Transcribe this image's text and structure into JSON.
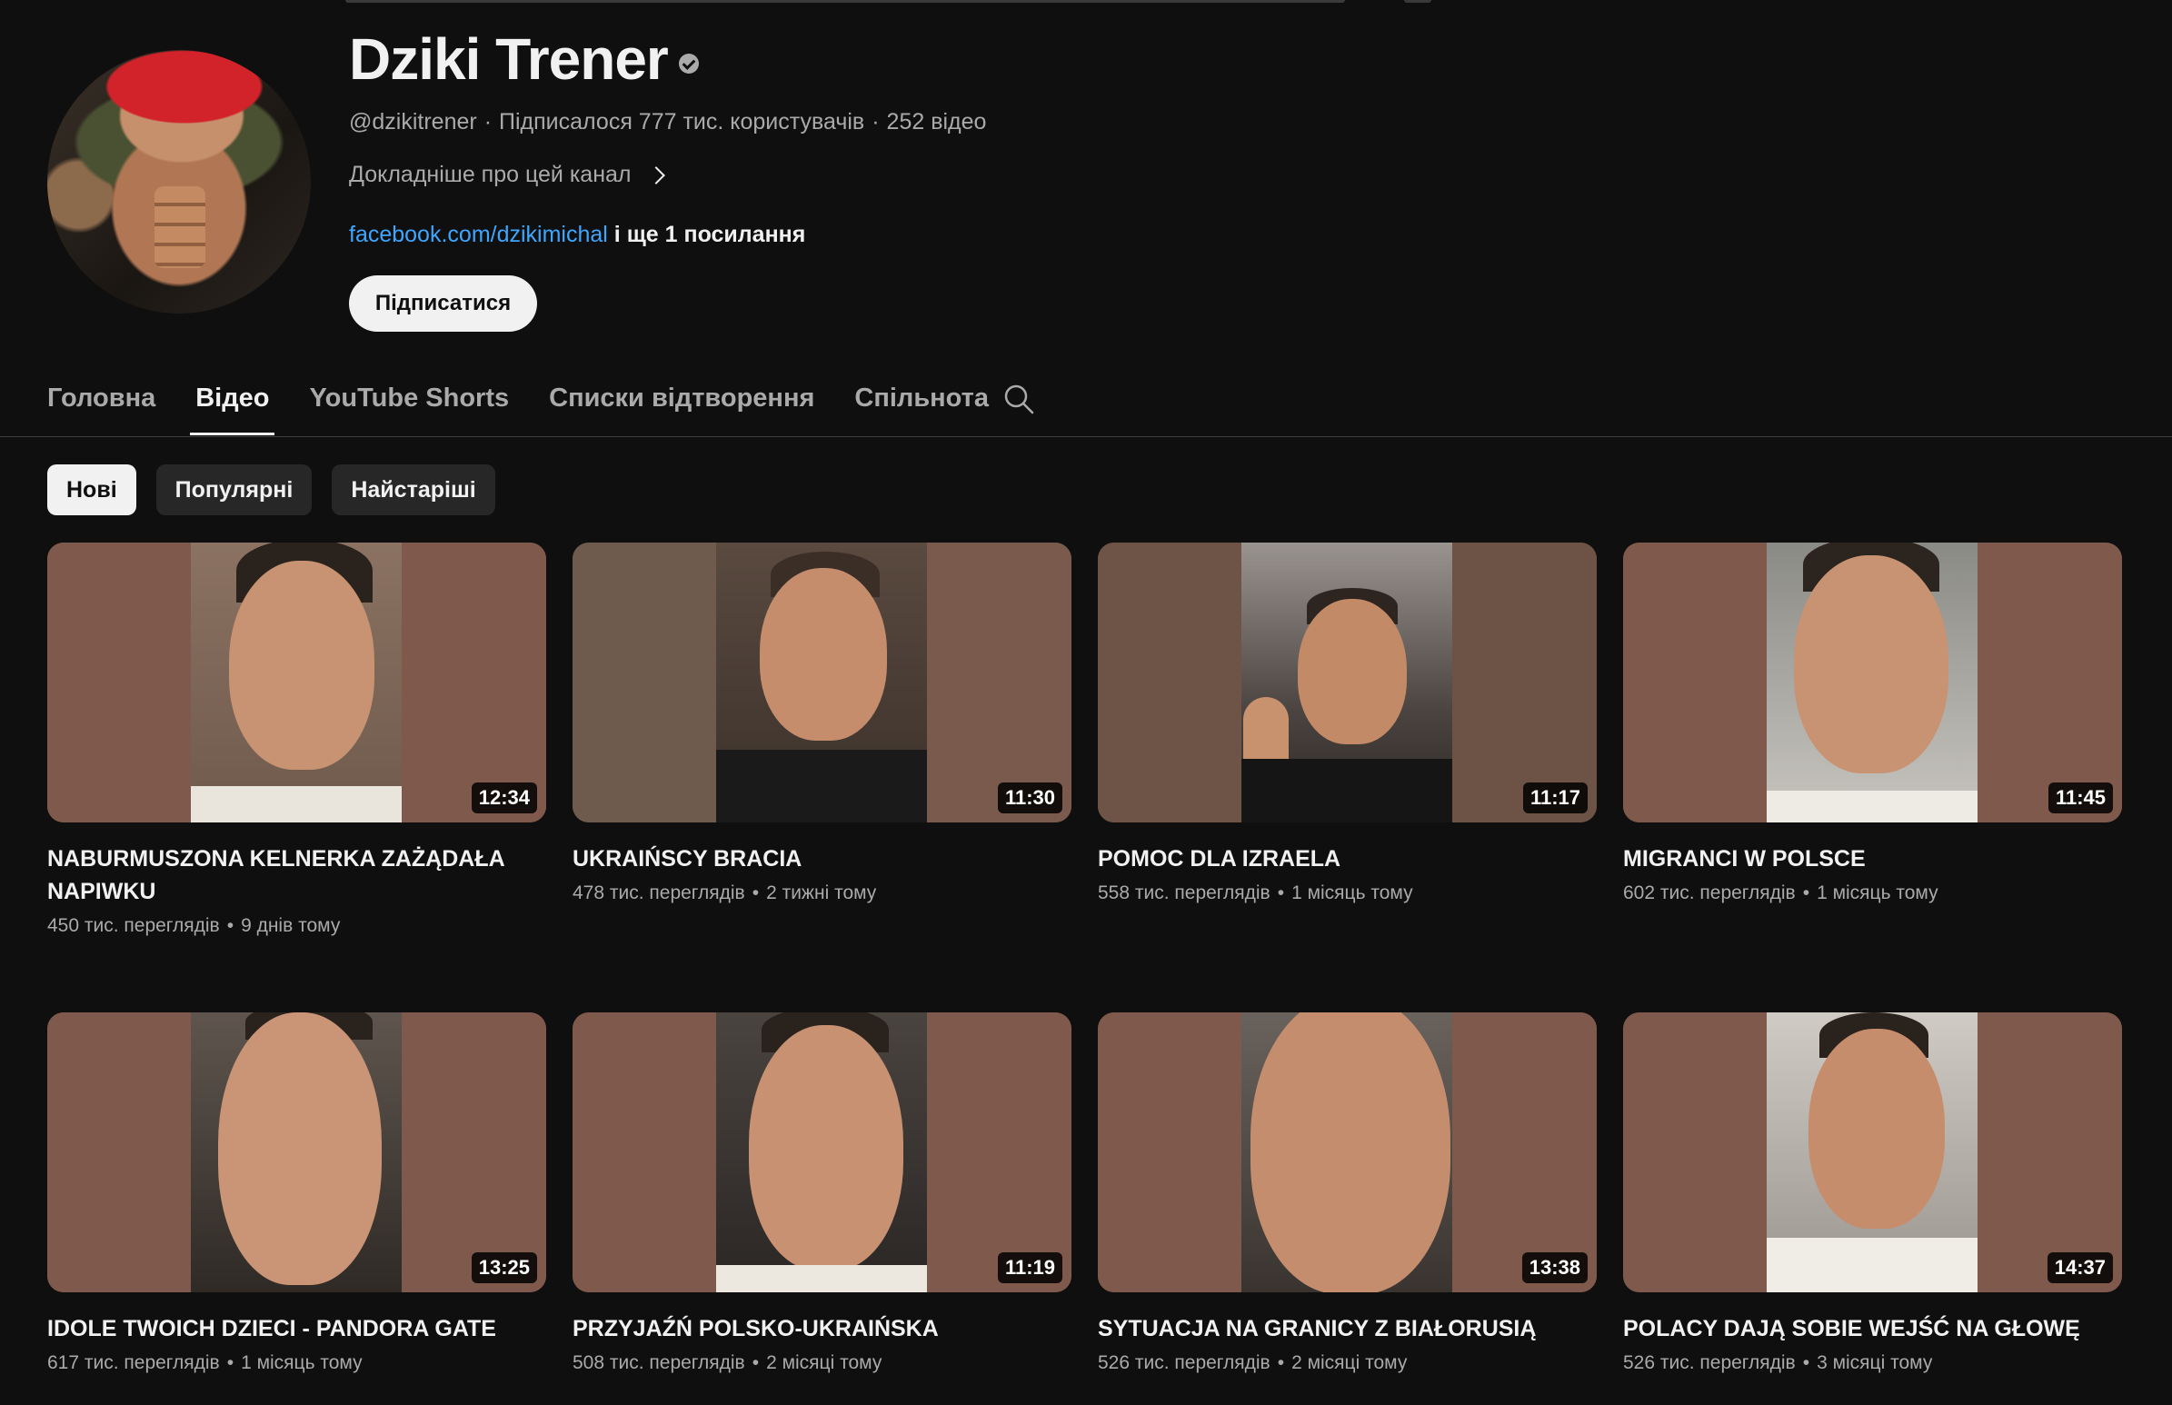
{
  "channel": {
    "name": "Dziki Trener",
    "handle": "@dzikitrener",
    "subscribers": "Підписалося 777 тис. користувачів",
    "video_count": "252 відео",
    "about_label": "Докладніше про цей канал",
    "link_text": "facebook.com/dzikimichal",
    "more_links": "і ще 1 посилання",
    "subscribe_label": "Підписатися"
  },
  "tabs": [
    {
      "label": "Головна",
      "active": false
    },
    {
      "label": "Відео",
      "active": true
    },
    {
      "label": "YouTube Shorts",
      "active": false
    },
    {
      "label": "Списки відтворення",
      "active": false
    },
    {
      "label": "Спільнота",
      "active": false
    }
  ],
  "chips": [
    {
      "label": "Нові",
      "active": true
    },
    {
      "label": "Популярні",
      "active": false
    },
    {
      "label": "Найстаріші",
      "active": false
    }
  ],
  "videos": [
    {
      "title": "NABURMUSZONA KELNERKA ZAŻĄDAŁA NAPIWKU",
      "views": "450 тис. переглядів",
      "age": "9 днів тому",
      "duration": "12:34"
    },
    {
      "title": "UKRAIŃSCY BRACIA",
      "views": "478 тис. переглядів",
      "age": "2 тижні тому",
      "duration": "11:30"
    },
    {
      "title": "POMOC DLA IZRAELA",
      "views": "558 тис. переглядів",
      "age": "1 місяць тому",
      "duration": "11:17"
    },
    {
      "title": "MIGRANCI W POLSCE",
      "views": "602 тис. переглядів",
      "age": "1 місяць тому",
      "duration": "11:45"
    },
    {
      "title": "IDOLE TWOICH DZIECI - PANDORA GATE",
      "views": "617 тис. переглядів",
      "age": "1 місяць тому",
      "duration": "13:25"
    },
    {
      "title": "PRZYJAŹŃ POLSKO-UKRAIŃSKA",
      "views": "508 тис. переглядів",
      "age": "2 місяці тому",
      "duration": "11:19"
    },
    {
      "title": "SYTUACJA NA GRANICY Z BIAŁORUSIĄ",
      "views": "526 тис. переглядів",
      "age": "2 місяці тому",
      "duration": "13:38"
    },
    {
      "title": "POLACY DAJĄ SOBIE WEJŚĆ NA GŁOWĘ",
      "views": "526 тис. переглядів",
      "age": "3 місяці тому",
      "duration": "14:37"
    }
  ],
  "icons": {
    "verified": "verified-check-icon",
    "search": "search-icon",
    "chevron": "chevron-right-icon"
  },
  "colors": {
    "background": "#0f0f0f",
    "link": "#3ea6ff",
    "thumbnail_panel": "#7f5a4c"
  }
}
